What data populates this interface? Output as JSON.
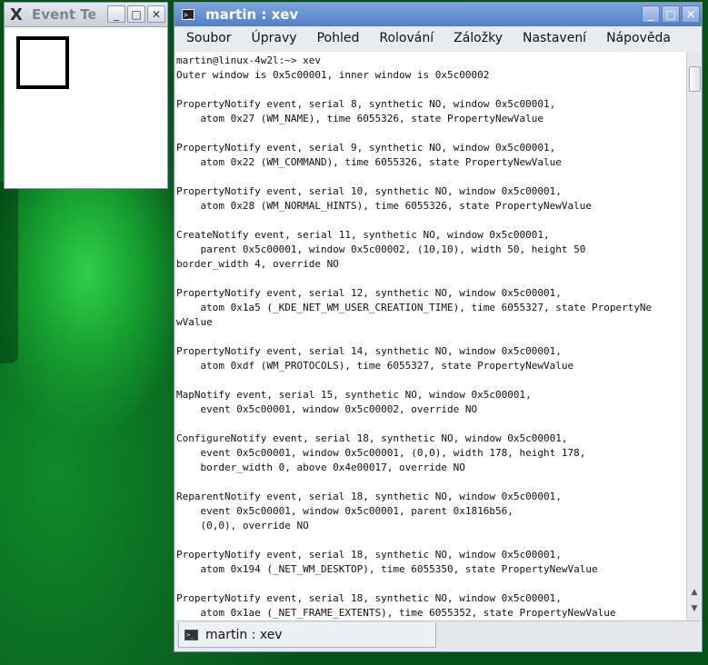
{
  "event_tester": {
    "title": "Event Te",
    "buttons": {
      "minimize": "_",
      "maximize": "□",
      "close": "✕"
    }
  },
  "konsole": {
    "title": "martin : xev",
    "buttons": {
      "minimize": "_",
      "maximize": "□",
      "close": "✕"
    },
    "menu": [
      "Soubor",
      "Úpravy",
      "Pohled",
      "Rolování",
      "Záložky",
      "Nastavení",
      "Nápověda"
    ],
    "terminal_lines": [
      "martin@linux-4w2l:~> xev",
      "Outer window is 0x5c00001, inner window is 0x5c00002",
      "",
      "PropertyNotify event, serial 8, synthetic NO, window 0x5c00001,",
      "    atom 0x27 (WM_NAME), time 6055326, state PropertyNewValue",
      "",
      "PropertyNotify event, serial 9, synthetic NO, window 0x5c00001,",
      "    atom 0x22 (WM_COMMAND), time 6055326, state PropertyNewValue",
      "",
      "PropertyNotify event, serial 10, synthetic NO, window 0x5c00001,",
      "    atom 0x28 (WM_NORMAL_HINTS), time 6055326, state PropertyNewValue",
      "",
      "CreateNotify event, serial 11, synthetic NO, window 0x5c00001,",
      "    parent 0x5c00001, window 0x5c00002, (10,10), width 50, height 50",
      "border_width 4, override NO",
      "",
      "PropertyNotify event, serial 12, synthetic NO, window 0x5c00001,",
      "    atom 0x1a5 (_KDE_NET_WM_USER_CREATION_TIME), time 6055327, state PropertyNe",
      "wValue",
      "",
      "PropertyNotify event, serial 14, synthetic NO, window 0x5c00001,",
      "    atom 0xdf (WM_PROTOCOLS), time 6055327, state PropertyNewValue",
      "",
      "MapNotify event, serial 15, synthetic NO, window 0x5c00001,",
      "    event 0x5c00001, window 0x5c00002, override NO",
      "",
      "ConfigureNotify event, serial 18, synthetic NO, window 0x5c00001,",
      "    event 0x5c00001, window 0x5c00001, (0,0), width 178, height 178,",
      "    border_width 0, above 0x4e00017, override NO",
      "",
      "ReparentNotify event, serial 18, synthetic NO, window 0x5c00001,",
      "    event 0x5c00001, window 0x5c00001, parent 0x1816b56,",
      "    (0,0), override NO",
      "",
      "PropertyNotify event, serial 18, synthetic NO, window 0x5c00001,",
      "    atom 0x194 (_NET_WM_DESKTOP), time 6055350, state PropertyNewValue",
      "",
      "PropertyNotify event, serial 18, synthetic NO, window 0x5c00001,",
      "    atom 0x1ae (_NET_FRAME_EXTENTS), time 6055352, state PropertyNewValue"
    ],
    "tab_label": "martin : xev"
  }
}
